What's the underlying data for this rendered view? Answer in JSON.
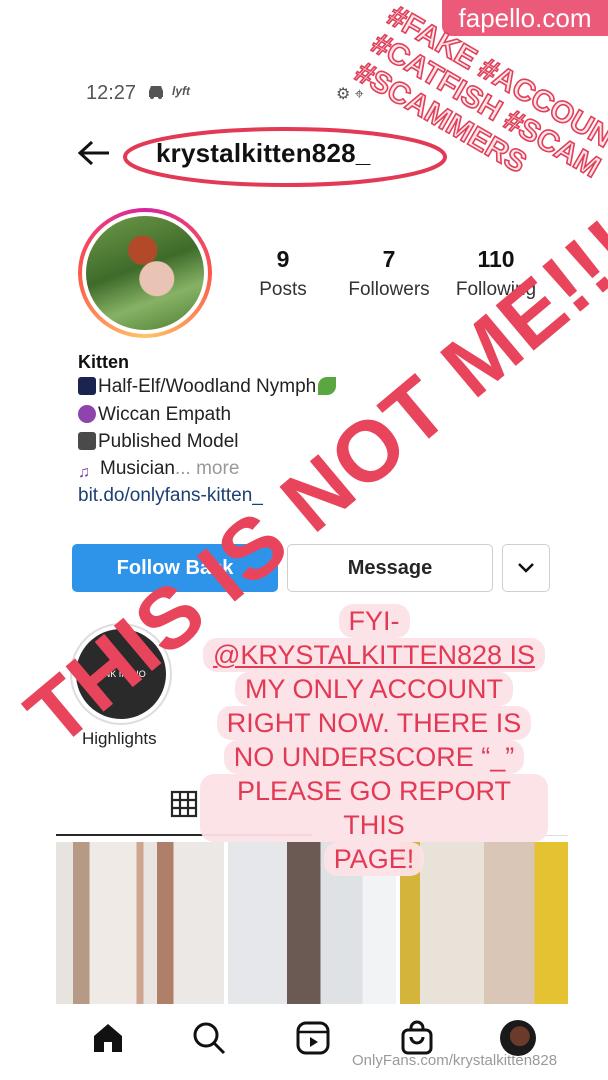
{
  "watermark": {
    "site": "fapello.com",
    "footer": "OnlyFans.com/krystalkitten828"
  },
  "status_bar": {
    "time": "12:27",
    "lyft": "lyft"
  },
  "header": {
    "username": "krystalkitten828_"
  },
  "stats": [
    {
      "value": "9",
      "label": "Posts"
    },
    {
      "value": "7",
      "label": "Followers"
    },
    {
      "value": "110",
      "label": "Following"
    }
  ],
  "bio": {
    "name": "Kitten",
    "lines": [
      "Half-Elf/Woodland Nymph",
      "Wiccan Empath",
      "Published Model",
      "Musician"
    ],
    "more": "... more",
    "link": "bit.do/onlyfans-kitten_"
  },
  "buttons": {
    "follow": "Follow Back",
    "message": "Message"
  },
  "highlights": [
    {
      "label": "Highlights",
      "cover_text": "LINK IN BIO"
    }
  ],
  "overlay": {
    "tags": [
      "#FAKE #ACCOUNT",
      "#CATFISH #SCAM",
      "#SCAMMERS"
    ],
    "big_text": "THIS IS NOT ME!!!!",
    "fyi_lines": [
      "FYI-",
      "@KRYSTALKITTEN828 IS",
      "MY ONLY ACCOUNT",
      "RIGHT NOW. THERE IS",
      "NO UNDERSCORE “_”",
      "PLEASE GO REPORT THIS",
      "PAGE!"
    ]
  },
  "colors": {
    "accent_pink": "#e8455d",
    "follow_blue": "#2d94ea"
  }
}
